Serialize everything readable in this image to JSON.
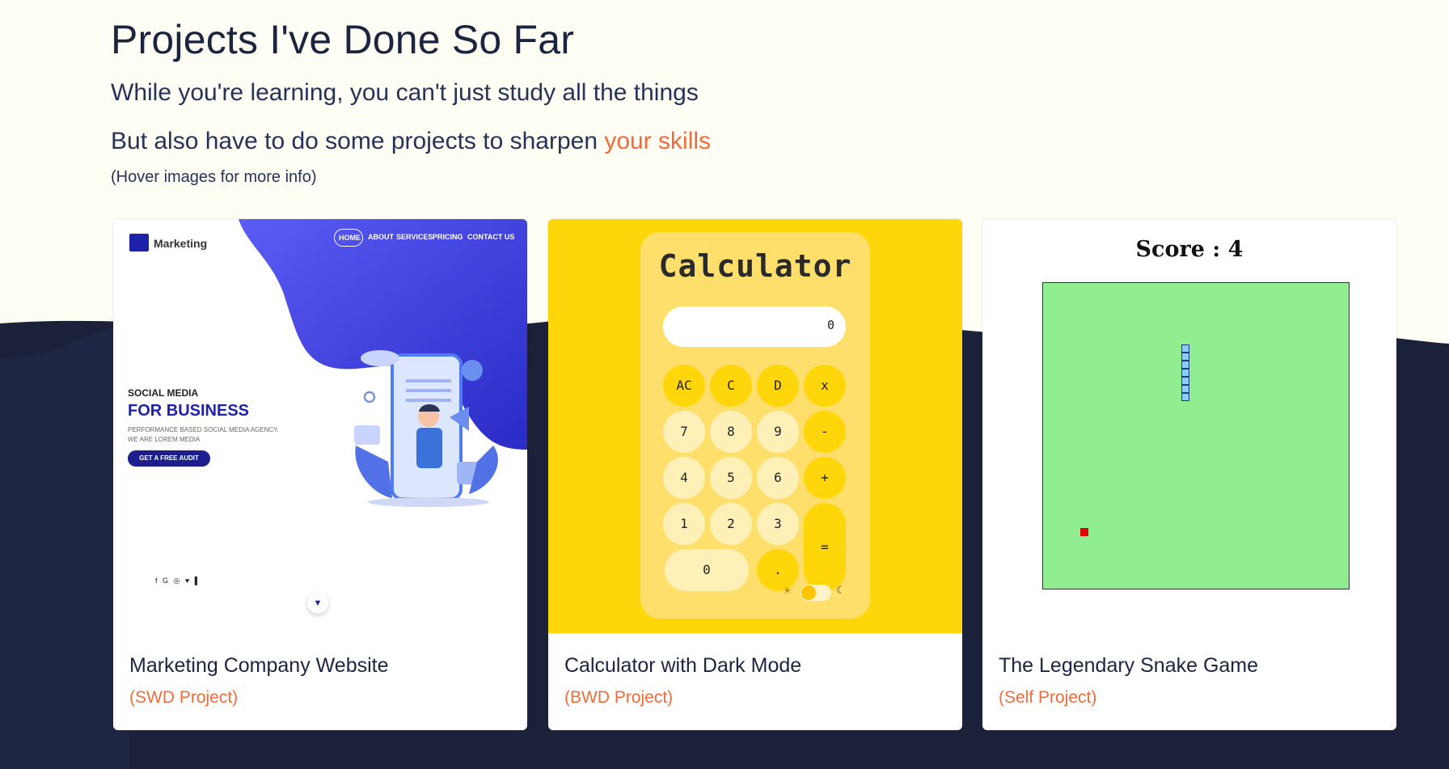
{
  "header": {
    "title": "Projects I've Done So Far",
    "line1": "While you're learning, you can't just study all the things",
    "line2_prefix": "But also have to do some projects to sharpen ",
    "line2_accent": "your skills",
    "hint": "(Hover images for more info)"
  },
  "colors": {
    "background": "#fefef5",
    "wave": "#1b2138",
    "accent": "#f26b3a",
    "text": "#1c2540"
  },
  "projects": [
    {
      "title": "Marketing Company Website",
      "subtitle": "(SWD Project)",
      "preview": {
        "logo_text": "Marketing",
        "nav": [
          "HOME",
          "ABOUT",
          "SERVICES",
          "PRICING",
          "CONTACT US"
        ],
        "kicker": "SOCIAL MEDIA",
        "headline": "FOR BUSINESS",
        "desc1": "PERFORMANCE BASED SOCIAL MEDIA AGENCY.",
        "desc2": "WE ARE LOREM MEDIA",
        "cta": "GET A FREE AUDIT",
        "social": "f G ◎ ♥ ▌",
        "scroll_icon": "arrow-down-icon"
      }
    },
    {
      "title": "Calculator with Dark Mode",
      "subtitle": "(BWD Project)",
      "preview": {
        "heading": "Calculator",
        "display": "0",
        "keys": [
          "AC",
          "C",
          "D",
          "x",
          "7",
          "8",
          "9",
          "-",
          "4",
          "5",
          "6",
          "+",
          "1",
          "2",
          "3",
          "=",
          "0",
          "."
        ],
        "sun_icon": "☀",
        "moon_icon": "☾"
      }
    },
    {
      "title": "The Legendary Snake Game",
      "subtitle": "(Self Project)",
      "preview": {
        "score": "Score : 4"
      }
    }
  ]
}
